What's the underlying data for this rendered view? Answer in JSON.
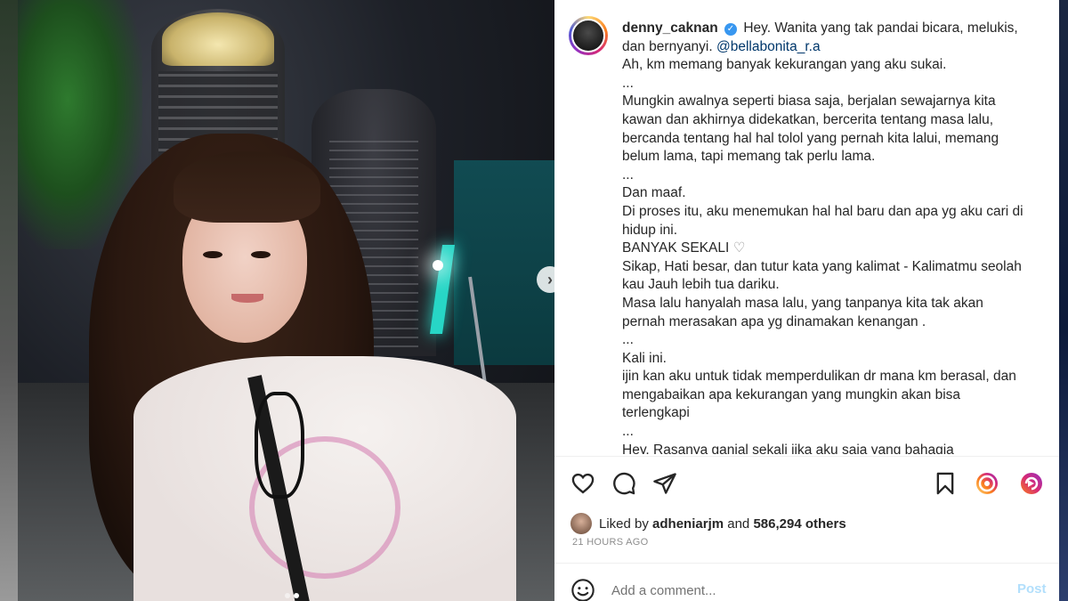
{
  "post": {
    "username": "denny_caknan",
    "caption_lines": [
      "Hey. Wanita yang tak pandai bicara, melukis,",
      "dan bernyanyi.",
      "Ah, km memang banyak kekurangan yang aku sukai.",
      "...",
      "Mungkin awalnya seperti biasa saja, berjalan sewajarnya kita",
      "kawan dan akhirnya didekatkan, bercerita tentang masa lalu,",
      "bercanda tentang hal hal tolol yang pernah kita lalui, memang",
      "belum lama, tapi memang tak perlu lama.",
      "...",
      "Dan maaf.",
      "Di proses itu, aku menemukan hal hal baru dan apa yg aku cari di",
      "hidup ini.",
      "BANYAK SEKALI",
      "Sikap, Hati besar, dan tutur kata yang kalimat - Kalimatmu seolah",
      "kau Jauh lebih tua dariku.",
      "Masa lalu hanyalah masa lalu, yang tanpanya kita tak akan",
      "pernah merasakan apa yg dinamakan kenangan .",
      "...",
      "Kali ini.",
      "ijin kan aku untuk tidak memperdulikan dr mana km berasal, dan",
      "mengabaikan apa kekurangan yang mungkin akan bisa",
      "terlengkapi",
      "...",
      "Hey. Rasanya ganjal sekali jika aku saja yang bahagia"
    ],
    "mention": "@bellabonita_r.a",
    "heart_glyph": "♡",
    "verified_glyph": "✓"
  },
  "engagement": {
    "liked_prefix": "Liked by",
    "liked_user": "adheniarjm",
    "liked_and": "and",
    "liked_count": "586,294 others",
    "timestamp": "21 HOURS AGO"
  },
  "comment": {
    "placeholder": "Add a comment...",
    "post_label": "Post"
  },
  "photo": {
    "next_glyph": "›",
    "carousel": {
      "count": 2,
      "active_index": 1
    }
  },
  "colors": {
    "link": "#00376b",
    "verified": "#3897f0",
    "post_disabled": "#b2dffc"
  },
  "icons": [
    "heart-icon",
    "comment-icon",
    "share-icon",
    "bookmark-icon",
    "story-ring-icon",
    "reel-icon",
    "emoji-icon"
  ]
}
